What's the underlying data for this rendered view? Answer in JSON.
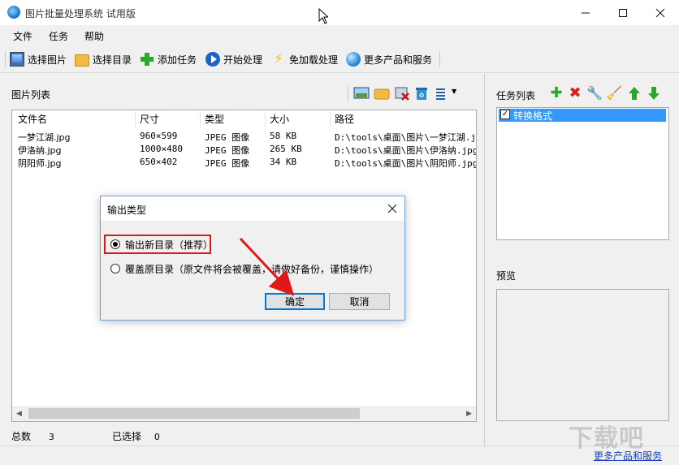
{
  "window": {
    "title": "图片批量处理系统 试用版",
    "minimize_icon": "minimize-icon",
    "maximize_icon": "maximize-icon",
    "close_icon": "close-icon"
  },
  "menu": [
    "文件",
    "任务",
    "帮助"
  ],
  "toolbar": [
    {
      "label": "选择图片",
      "icon": "monitor-icon"
    },
    {
      "label": "选择目录",
      "icon": "folder-icon"
    },
    {
      "label": "添加任务",
      "icon": "plus-icon"
    },
    {
      "label": "开始处理",
      "icon": "play-icon"
    },
    {
      "label": "免加载处理",
      "icon": "bolt-icon"
    },
    {
      "label": "更多产品和服务",
      "icon": "globe-icon"
    }
  ],
  "image_list": {
    "title": "图片列表",
    "columns": [
      "文件名",
      "尺寸",
      "类型",
      "大小",
      "路径"
    ],
    "rows": [
      [
        "一梦江湖.jpg",
        "960×599",
        "JPEG 图像",
        "58 KB",
        "D:\\tools\\桌面\\图片\\一梦江湖.jpg"
      ],
      [
        "伊洛纳.jpg",
        "1000×480",
        "JPEG 图像",
        "265 KB",
        "D:\\tools\\桌面\\图片\\伊洛纳.jpg"
      ],
      [
        "阴阳师.jpg",
        "650×402",
        "JPEG 图像",
        "34 KB",
        "D:\\tools\\桌面\\图片\\阴阳师.jpg"
      ]
    ]
  },
  "status": {
    "total_label": "总数",
    "total_value": "3",
    "selected_label": "已选择",
    "selected_value": "0",
    "link": "更多产品和服务",
    "watermark": "下载吧"
  },
  "task_panel": {
    "title": "任务列表",
    "items": [
      {
        "label": "转换格式",
        "checked": true,
        "selected": true
      }
    ]
  },
  "preview_panel": {
    "title": "预览"
  },
  "dialog": {
    "title": "输出类型",
    "options": [
      {
        "label": "输出新目录（推荐）",
        "selected": true
      },
      {
        "label": "覆盖原目录（原文件将会被覆盖，请做好备份，谨慎操作）",
        "selected": false
      }
    ],
    "ok": "确定",
    "cancel": "取消"
  },
  "colors": {
    "accent": "#3399ff",
    "highlight_frame": "#e01818",
    "annotation_arrow": "#e01818",
    "link": "#1a3fc1"
  }
}
